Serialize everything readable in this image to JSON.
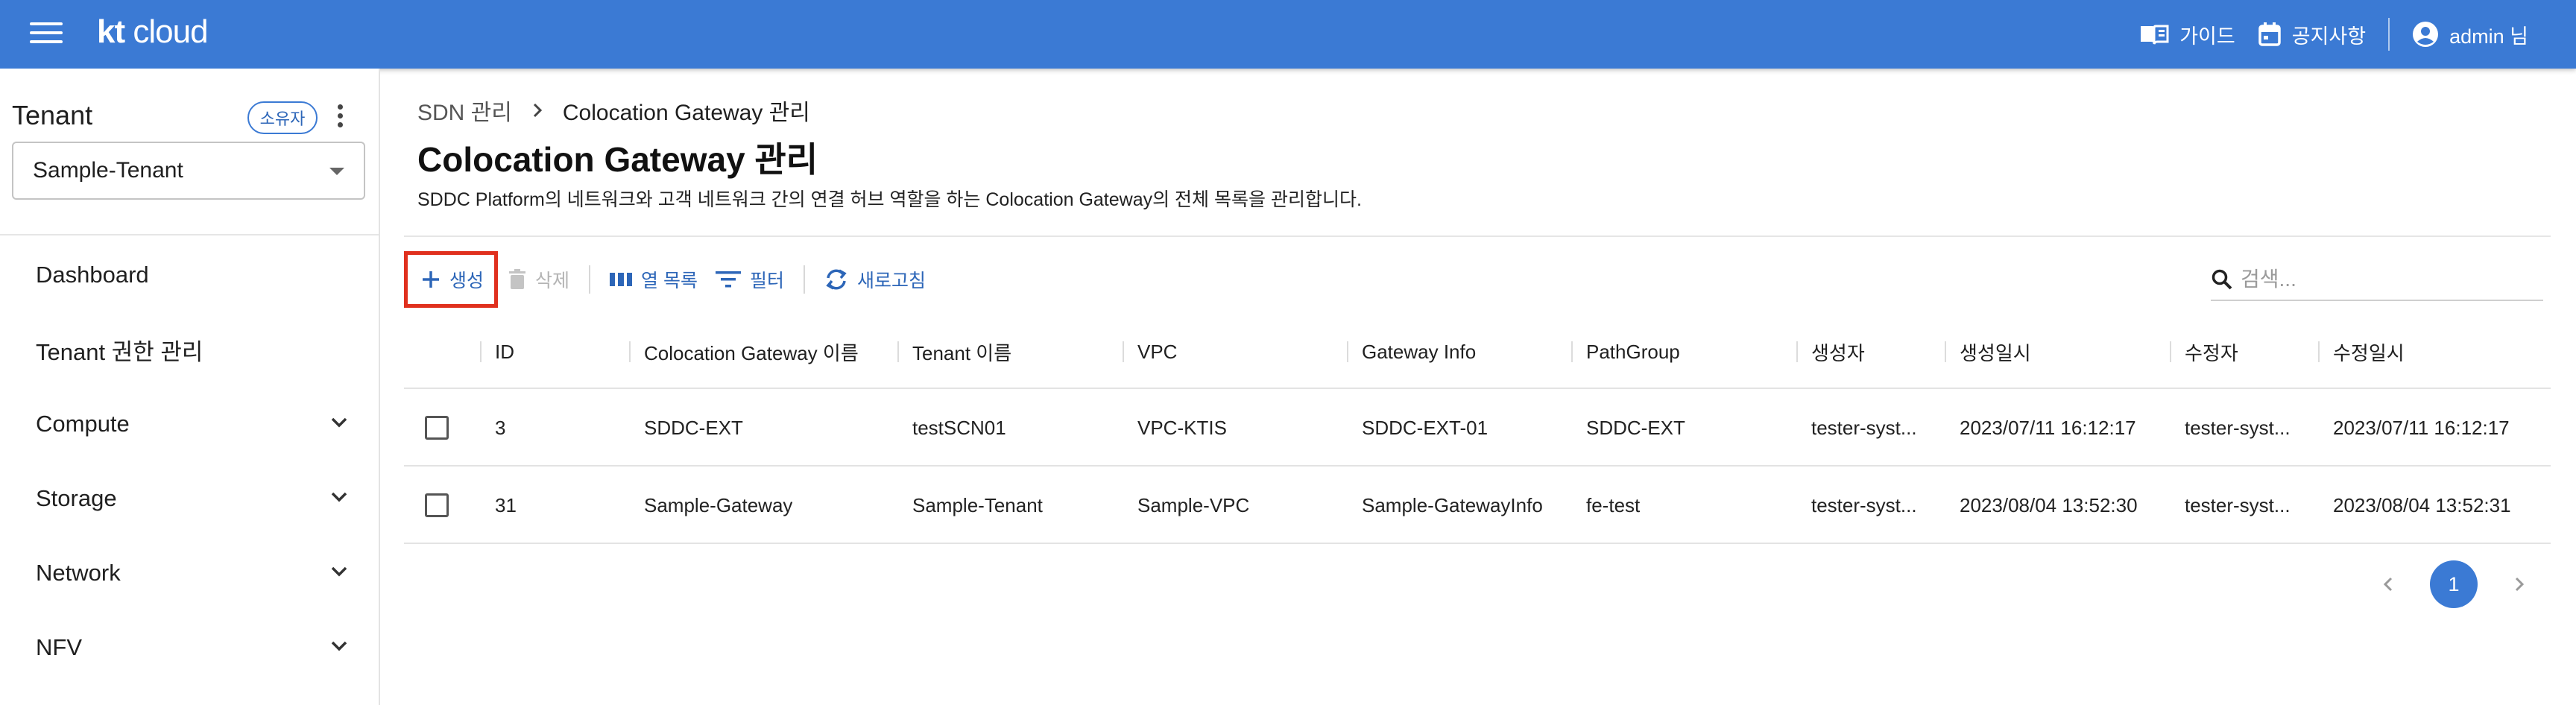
{
  "app": {
    "logo_kt": "kt",
    "logo_cloud": "cloud"
  },
  "topbar": {
    "guide_label": "가이드",
    "notice_label": "공지사항",
    "user_label": "admin 님"
  },
  "sidebar": {
    "tenant_title": "Tenant",
    "owner_badge": "소유자",
    "tenant_selected": "Sample-Tenant",
    "items": [
      {
        "label": "Dashboard",
        "expandable": false
      },
      {
        "label": "Tenant 권한 관리",
        "expandable": false
      },
      {
        "label": "Compute",
        "expandable": true
      },
      {
        "label": "Storage",
        "expandable": true
      },
      {
        "label": "Network",
        "expandable": true
      },
      {
        "label": "NFV",
        "expandable": true
      }
    ]
  },
  "breadcrumb": {
    "parent": "SDN 관리",
    "current": "Colocation Gateway 관리"
  },
  "page": {
    "title": "Colocation Gateway 관리",
    "description": "SDDC Platform의 네트워크와 고객 네트워크 간의 연결 허브 역할을 하는 Colocation Gateway의 전체 목록을 관리합니다."
  },
  "toolbar": {
    "create_label": "생성",
    "delete_label": "삭제",
    "columns_label": "열 목록",
    "filter_label": "필터",
    "refresh_label": "새로고침",
    "search_placeholder": "검색..."
  },
  "table": {
    "columns": [
      "ID",
      "Colocation Gateway 이름",
      "Tenant 이름",
      "VPC",
      "Gateway Info",
      "PathGroup",
      "생성자",
      "생성일시",
      "수정자",
      "수정일시"
    ],
    "rows": [
      [
        "3",
        "SDDC-EXT",
        "testSCN01",
        "VPC-KTIS",
        "SDDC-EXT-01",
        "SDDC-EXT",
        "tester-syst...",
        "2023/07/11 16:12:17",
        "tester-syst...",
        "2023/07/11 16:12:17"
      ],
      [
        "31",
        "Sample-Gateway",
        "Sample-Tenant",
        "Sample-VPC",
        "Sample-GatewayInfo",
        "fe-test",
        "tester-syst...",
        "2023/08/04 13:52:30",
        "tester-syst...",
        "2023/08/04 13:52:31"
      ]
    ]
  },
  "pagination": {
    "current_page": "1"
  },
  "colors": {
    "brand": "#3b7ad4",
    "link": "#2d66b8",
    "highlight_border": "#e0301e"
  }
}
